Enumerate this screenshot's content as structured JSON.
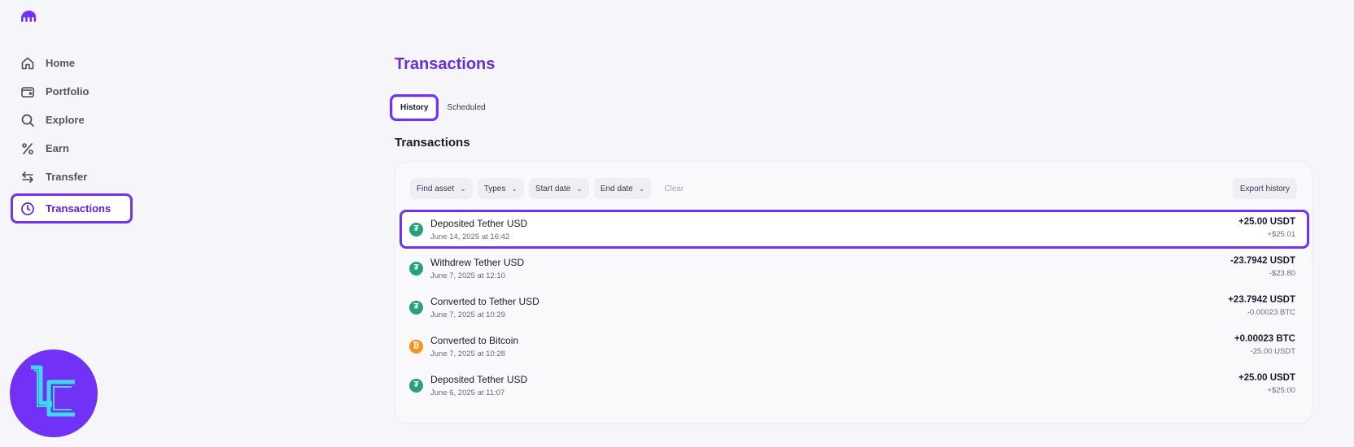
{
  "sidebar": {
    "items": [
      {
        "label": "Home",
        "icon": "home-icon"
      },
      {
        "label": "Portfolio",
        "icon": "wallet-icon"
      },
      {
        "label": "Explore",
        "icon": "search-icon"
      },
      {
        "label": "Earn",
        "icon": "percent-icon"
      },
      {
        "label": "Transfer",
        "icon": "transfer-arrows-icon"
      },
      {
        "label": "Transactions",
        "icon": "clock-icon",
        "active": true
      }
    ]
  },
  "main": {
    "title": "Transactions",
    "tabs": [
      {
        "label": "History",
        "active": true
      },
      {
        "label": "Scheduled",
        "active": false
      }
    ],
    "section_title": "Transactions",
    "filters": {
      "find_asset": "Find asset",
      "types": "Types",
      "start_date": "Start date",
      "end_date": "End date",
      "clear": "Clear",
      "export": "Export history"
    },
    "transactions": [
      {
        "title": "Deposited Tether USD",
        "date": "June 14, 2025 at 16:42",
        "amount": "+25.00 USDT",
        "sub": "+$25.01",
        "coin": "usdt",
        "highlight": true
      },
      {
        "title": "Withdrew Tether USD",
        "date": "June 7, 2025 at 12:10",
        "amount": "-23.7942 USDT",
        "sub": "-$23.80",
        "coin": "usdt"
      },
      {
        "title": "Converted to Tether USD",
        "date": "June 7, 2025 at 10:29",
        "amount": "+23.7942 USDT",
        "sub": "-0.00023 BTC",
        "coin": "usdt"
      },
      {
        "title": "Converted to Bitcoin",
        "date": "June 7, 2025 at 10:28",
        "amount": "+0.00023 BTC",
        "sub": "-25.00 USDT",
        "coin": "btc"
      },
      {
        "title": "Deposited Tether USD",
        "date": "June 6, 2025 at 11:07",
        "amount": "+25.00 USDT",
        "sub": "+$25.00",
        "coin": "usdt"
      }
    ]
  },
  "colors": {
    "accent": "#7132f5",
    "title": "#6a2fd8",
    "usdt": "#26a17b",
    "btc": "#f7931a"
  }
}
